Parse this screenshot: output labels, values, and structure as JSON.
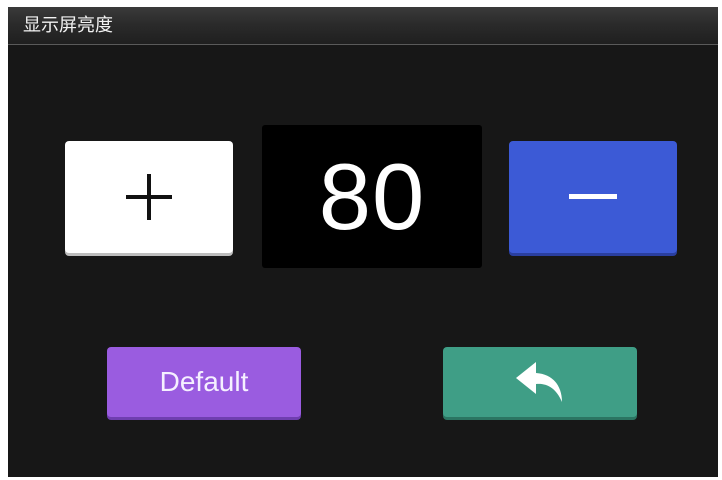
{
  "header": {
    "title": "显示屏亮度"
  },
  "brightness": {
    "value": "80"
  },
  "buttons": {
    "increase_icon": "plus-icon",
    "decrease_icon": "minus-icon",
    "default_label": "Default",
    "back_icon": "reply-arrow-icon"
  },
  "colors": {
    "screen_bg": "#171717",
    "increase_button": "#ffffff",
    "decrease_button": "#3c5ad6",
    "value_box": "#000000",
    "default_button": "#9a5ce0",
    "back_button": "#3f9e86"
  }
}
